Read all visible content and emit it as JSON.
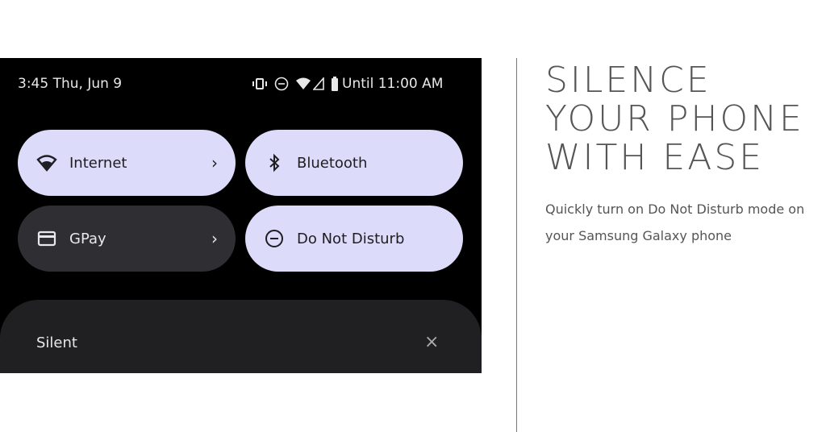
{
  "status_bar": {
    "time_date": "3:45 Thu, Jun 9",
    "dnd_until": "Until 11:00 AM",
    "icons": [
      "vibrate-icon",
      "dnd-icon",
      "wifi-icon",
      "signal-icon",
      "battery-icon"
    ]
  },
  "tiles": [
    {
      "label": "Internet",
      "icon": "wifi-icon",
      "active": true,
      "chevron": true
    },
    {
      "label": "Bluetooth",
      "icon": "bluetooth-icon",
      "active": true,
      "chevron": false
    },
    {
      "label": "GPay",
      "icon": "card-icon",
      "active": false,
      "chevron": true
    },
    {
      "label": "Do Not Disturb",
      "icon": "dnd-icon",
      "active": true,
      "chevron": false
    }
  ],
  "notification": {
    "label": "Silent",
    "close": "×"
  },
  "chevron": "›",
  "headline": "SILENCE\nYOUR PHONE\nWITH EASE",
  "description": "Quickly turn on Do Not Disturb mode on your Samsung Galaxy phone",
  "colors": {
    "tile_active": "#dcdcfa",
    "tile_inactive": "#2f2f33",
    "text": "#555555"
  }
}
